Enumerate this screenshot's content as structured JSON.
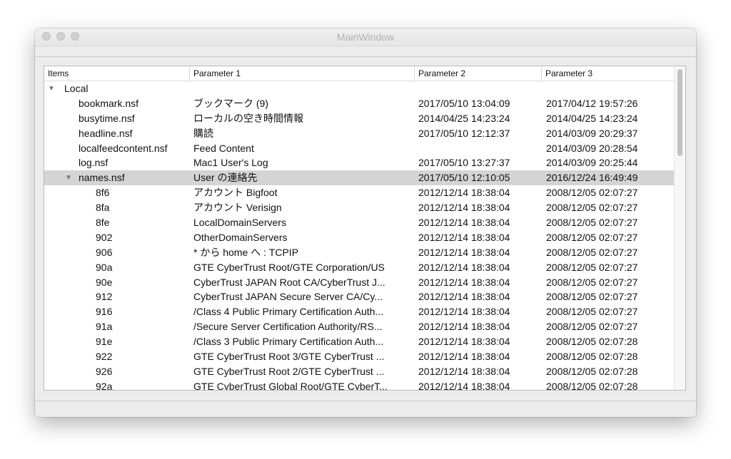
{
  "window": {
    "title": "MainWindow"
  },
  "tree": {
    "columns": [
      "Items",
      "Parameter 1",
      "Parameter 2",
      "Parameter 3"
    ],
    "rows": [
      {
        "item": "Local",
        "p1": "",
        "p2": "",
        "p3": "",
        "level": 0,
        "expanded": true,
        "selected": false
      },
      {
        "item": "bookmark.nsf",
        "p1": "ブックマーク (9)",
        "p2": "2017/05/10 13:04:09",
        "p3": "2017/04/12 19:57:26",
        "level": 1,
        "selected": false
      },
      {
        "item": "busytime.nsf",
        "p1": "ローカルの空き時間情報",
        "p2": "2014/04/25 14:23:24",
        "p3": "2014/04/25 14:23:24",
        "level": 1,
        "selected": false
      },
      {
        "item": "headline.nsf",
        "p1": "購読",
        "p2": "2017/05/10 12:12:37",
        "p3": "2014/03/09 20:29:37",
        "level": 1,
        "selected": false
      },
      {
        "item": "localfeedcontent.nsf",
        "p1": "Feed Content",
        "p2": "",
        "p3": "2014/03/09 20:28:54",
        "level": 1,
        "selected": false
      },
      {
        "item": "log.nsf",
        "p1": "Mac1 User's Log",
        "p2": "2017/05/10 13:27:37",
        "p3": "2014/03/09 20:25:44",
        "level": 1,
        "selected": false
      },
      {
        "item": "names.nsf",
        "p1": "User の連絡先",
        "p2": "2017/05/10 12:10:05",
        "p3": "2016/12/24 16:49:49",
        "level": 1,
        "expanded": true,
        "selected": true
      },
      {
        "item": "8f6",
        "p1": "アカウント Bigfoot",
        "p2": "2012/12/14 18:38:04",
        "p3": "2008/12/05 02:07:27",
        "level": 2,
        "selected": false
      },
      {
        "item": "8fa",
        "p1": "アカウント Verisign",
        "p2": "2012/12/14 18:38:04",
        "p3": "2008/12/05 02:07:27",
        "level": 2,
        "selected": false
      },
      {
        "item": "8fe",
        "p1": "LocalDomainServers",
        "p2": "2012/12/14 18:38:04",
        "p3": "2008/12/05 02:07:27",
        "level": 2,
        "selected": false
      },
      {
        "item": "902",
        "p1": "OtherDomainServers",
        "p2": "2012/12/14 18:38:04",
        "p3": "2008/12/05 02:07:27",
        "level": 2,
        "selected": false
      },
      {
        "item": "906",
        "p1": "* から home へ : TCPIP",
        "p2": "2012/12/14 18:38:04",
        "p3": "2008/12/05 02:07:27",
        "level": 2,
        "selected": false
      },
      {
        "item": "90a",
        "p1": "GTE CyberTrust Root/GTE Corporation/US",
        "p2": "2012/12/14 18:38:04",
        "p3": "2008/12/05 02:07:27",
        "level": 2,
        "selected": false
      },
      {
        "item": "90e",
        "p1": "CyberTrust JAPAN Root CA/CyberTrust J...",
        "p2": "2012/12/14 18:38:04",
        "p3": "2008/12/05 02:07:27",
        "level": 2,
        "selected": false
      },
      {
        "item": "912",
        "p1": "CyberTrust JAPAN Secure Server CA/Cy...",
        "p2": "2012/12/14 18:38:04",
        "p3": "2008/12/05 02:07:27",
        "level": 2,
        "selected": false
      },
      {
        "item": "916",
        "p1": "/Class 4 Public Primary Certification Auth...",
        "p2": "2012/12/14 18:38:04",
        "p3": "2008/12/05 02:07:27",
        "level": 2,
        "selected": false
      },
      {
        "item": "91a",
        "p1": "/Secure Server Certification Authority/RS...",
        "p2": "2012/12/14 18:38:04",
        "p3": "2008/12/05 02:07:27",
        "level": 2,
        "selected": false
      },
      {
        "item": "91e",
        "p1": "/Class 3 Public Primary Certification Auth...",
        "p2": "2012/12/14 18:38:04",
        "p3": "2008/12/05 02:07:28",
        "level": 2,
        "selected": false
      },
      {
        "item": "922",
        "p1": "GTE CyberTrust Root 3/GTE CyberTrust ...",
        "p2": "2012/12/14 18:38:04",
        "p3": "2008/12/05 02:07:28",
        "level": 2,
        "selected": false
      },
      {
        "item": "926",
        "p1": "GTE CyberTrust Root 2/GTE CyberTrust ...",
        "p2": "2012/12/14 18:38:04",
        "p3": "2008/12/05 02:07:28",
        "level": 2,
        "selected": false
      },
      {
        "item": "92a",
        "p1": "GTE CyberTrust Global Root/GTE CyberT...",
        "p2": "2012/12/14 18:38:04",
        "p3": "2008/12/05 02:07:28",
        "level": 2,
        "selected": false
      }
    ]
  },
  "icons": {
    "expanded": "triangle-down-icon"
  },
  "colors": {
    "selected_row": "#d4d4d4",
    "window_bg": "#ececec",
    "title_text": "#b0b0b0"
  }
}
